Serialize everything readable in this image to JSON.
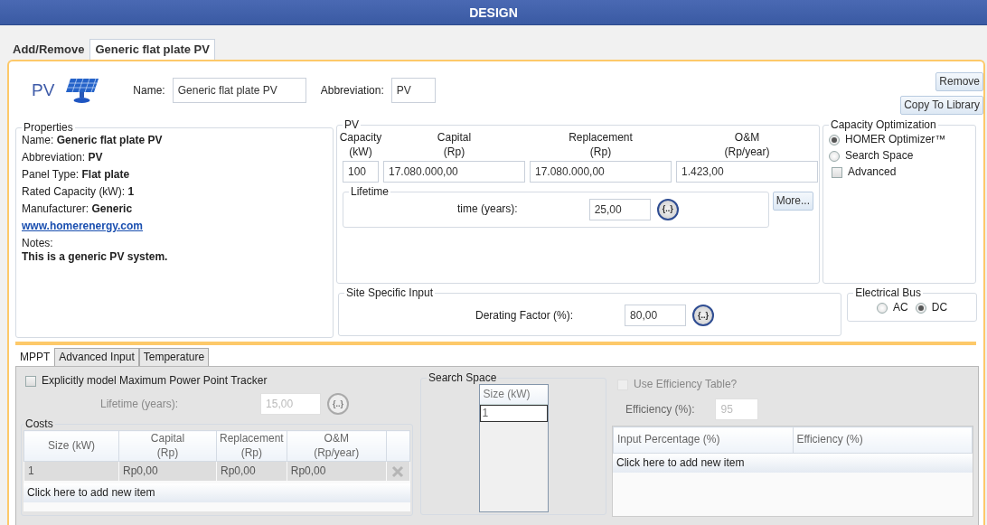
{
  "header": {
    "title": "DESIGN"
  },
  "tabs": [
    {
      "label": "Add/Remove",
      "selected": false
    },
    {
      "label": "Generic flat plate PV",
      "selected": true
    }
  ],
  "component": {
    "logo": "PV",
    "name_label": "Name:",
    "name_value": "Generic flat plate PV",
    "abbreviation_label": "Abbreviation:",
    "abbreviation_value": "PV"
  },
  "buttons": [
    "Remove",
    "Copy To Library"
  ],
  "properties": {
    "title": "Properties",
    "items": [
      {
        "label": "Name:",
        "value": "Generic flat plate PV"
      },
      {
        "label": "Abbreviation:",
        "value": "PV"
      },
      {
        "label": "Panel Type:",
        "value": "Flat plate"
      },
      {
        "label": "Rated Capacity (kW):",
        "value": "1"
      },
      {
        "label": "Manufacturer:",
        "value": "Generic"
      }
    ],
    "link": "www.homerenergy.com",
    "notes_label": "Notes:",
    "notes": "This is a generic PV system."
  },
  "pv": {
    "title": "PV",
    "columns": [
      {
        "label": "Capacity",
        "unit": "(kW)",
        "value": "100"
      },
      {
        "label": "Capital",
        "unit": "(Rp)",
        "value": "17.080.000,00"
      },
      {
        "label": "Replacement",
        "unit": "(Rp)",
        "value": "17.080.000,00"
      },
      {
        "label": "O&M",
        "unit": "(Rp/year)",
        "value": "1.423,00"
      }
    ],
    "lifetime": {
      "title": "Lifetime",
      "label": "time (years):",
      "value": "25,00",
      "sensitivity": "{..}"
    },
    "more_button": "More..."
  },
  "capacity_optimization": {
    "title": "Capacity Optimization",
    "options": [
      {
        "label": "HOMER Optimizer™",
        "selected": true
      },
      {
        "label": "Search Space",
        "selected": false
      }
    ],
    "advanced": {
      "label": "Advanced",
      "checked": false
    }
  },
  "site_specific": {
    "title": "Site Specific Input",
    "label": "Derating Factor (%):",
    "value": "80,00",
    "sensitivity": "{..}"
  },
  "electrical_bus": {
    "title": "Electrical Bus",
    "options": [
      {
        "label": "AC",
        "selected": false
      },
      {
        "label": "DC",
        "selected": true
      }
    ]
  },
  "sub_tabs": [
    {
      "label": "MPPT",
      "selected": true
    },
    {
      "label": "Advanced Input",
      "selected": false
    },
    {
      "label": "Temperature",
      "selected": false
    }
  ],
  "mppt": {
    "explicit": {
      "label": "Explicitly model Maximum Power Point Tracker",
      "checked": false
    },
    "lifetime": {
      "label": "Lifetime (years):",
      "value": "15,00",
      "sensitivity": "{..}",
      "disabled": true
    },
    "costs": {
      "title": "Costs",
      "columns": [
        {
          "label": "Size (kW)"
        },
        {
          "label": "Capital",
          "unit": "(Rp)"
        },
        {
          "label": "Replacement",
          "unit": "(Rp)"
        },
        {
          "label": "O&M",
          "unit": "(Rp/year)"
        }
      ],
      "rows": [
        [
          "1",
          "Rp0,00",
          "Rp0,00",
          "Rp0,00"
        ]
      ],
      "add_row": "Click here to add new item"
    },
    "search_space": {
      "title": "Search Space",
      "column": "Size (kW)",
      "rows": [
        "1"
      ]
    },
    "efficiency": {
      "use_table": {
        "label": "Use Efficiency Table?",
        "checked": false,
        "disabled": true
      },
      "label": "Efficiency (%):",
      "value": "95",
      "disabled": true,
      "columns": [
        "Input Percentage (%)",
        "Efficiency (%)"
      ],
      "add_row": "Click here to add new item"
    }
  }
}
